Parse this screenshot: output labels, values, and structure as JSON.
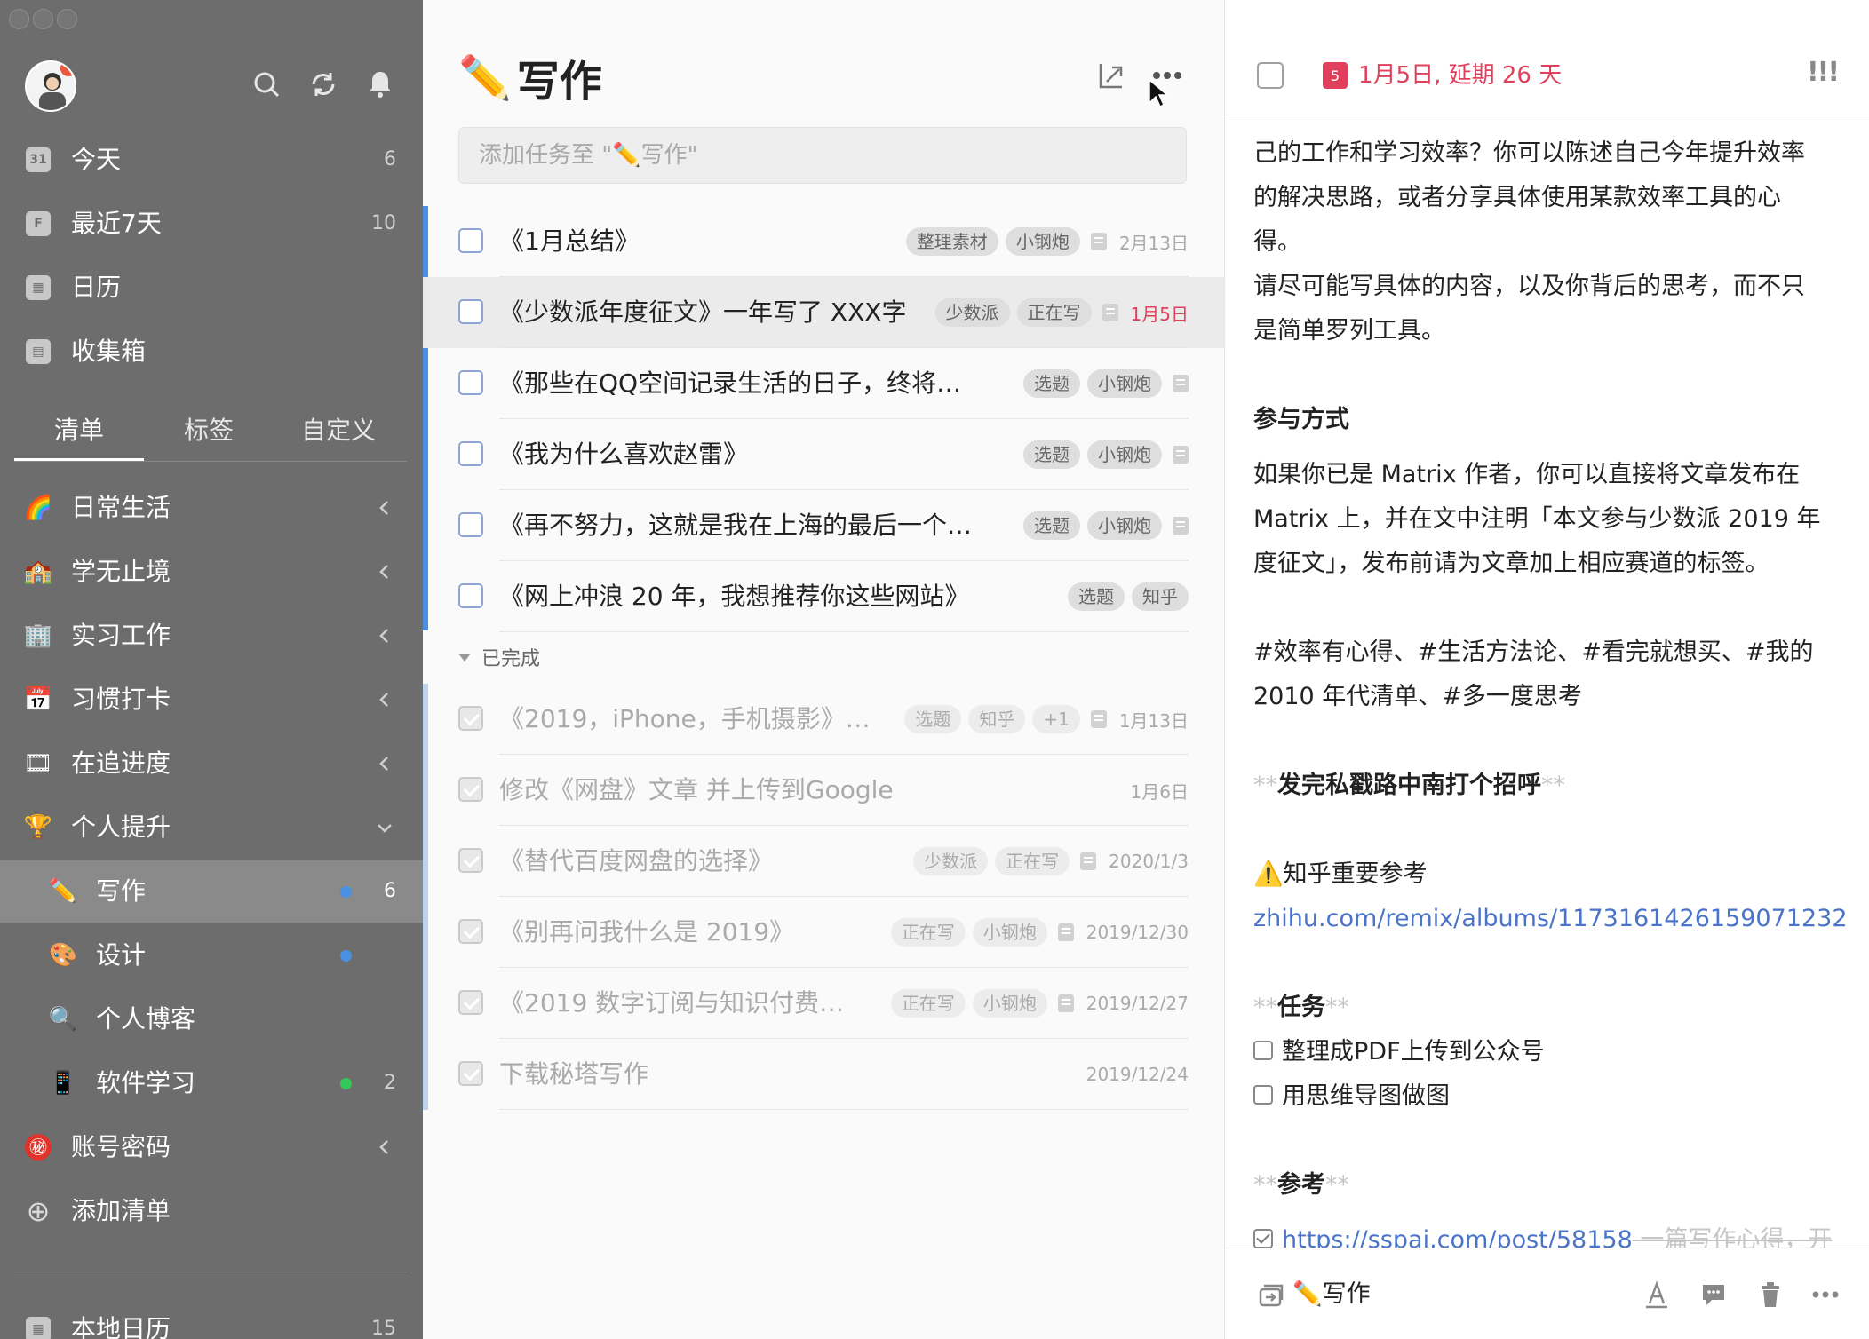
{
  "sidebar": {
    "smart_lists": [
      {
        "icon": "calendar-today-icon",
        "glyph": "31",
        "label": "今天",
        "count": "6"
      },
      {
        "icon": "calendar-week-icon",
        "glyph": "F",
        "label": "最近7天",
        "count": "10"
      },
      {
        "icon": "calendar-icon",
        "glyph": "▦",
        "label": "日历",
        "count": ""
      },
      {
        "icon": "inbox-icon",
        "glyph": "▤",
        "label": "收集箱",
        "count": ""
      }
    ],
    "tabs": [
      "清单",
      "标签",
      "自定义"
    ],
    "lists": [
      {
        "icon": "rainbow-icon",
        "glyph": "🌈",
        "label": "日常生活"
      },
      {
        "icon": "school-icon",
        "glyph": "🏫",
        "label": "学无止境"
      },
      {
        "icon": "office-icon",
        "glyph": "🏢",
        "label": "实习工作"
      },
      {
        "icon": "calendar-17-icon",
        "glyph": "📅",
        "label": "习惯打卡"
      },
      {
        "icon": "film-icon",
        "glyph": "🎞",
        "label": "在追进度"
      },
      {
        "icon": "trophy-icon",
        "glyph": "🏆",
        "label": "个人提升"
      }
    ],
    "sub_lists": [
      {
        "icon": "pencil-icon",
        "glyph": "✏️",
        "label": "写作",
        "count": "6",
        "dot": "#4a90e2"
      },
      {
        "icon": "palette-icon",
        "glyph": "🎨",
        "label": "设计",
        "count": "",
        "dot": "#4a90e2"
      },
      {
        "icon": "magnifier-icon",
        "glyph": "🔍",
        "label": "个人博客",
        "count": "",
        "dot": ""
      },
      {
        "icon": "app-icon",
        "glyph": "📱",
        "label": "软件学习",
        "count": "2",
        "dot": "#34c759"
      }
    ],
    "extra_lists": [
      {
        "icon": "secret-icon",
        "glyph": "㊙",
        "label": "账号密码"
      },
      {
        "icon": "add-circle-icon",
        "glyph": "⊕",
        "label": "添加清单"
      }
    ],
    "bottom": {
      "label": "本地日历",
      "count": "15"
    }
  },
  "list": {
    "title_emoji": "✏️",
    "title": "写作",
    "add_placeholder": "添加任务至 \"✏️写作\"",
    "tasks": [
      {
        "title": "《1月总结》",
        "tags": [
          "整理素材",
          "小钢炮"
        ],
        "note": true,
        "date": "2月13日",
        "date_red": false
      },
      {
        "title": "《少数派年度征文》一年写了 XXX字",
        "tags": [
          "少数派",
          "正在写"
        ],
        "note": true,
        "date": "1月5日",
        "date_red": true
      },
      {
        "title": "《那些在QQ空间记录生活的日子，终将…",
        "tags": [
          "选题",
          "小钢炮"
        ],
        "note": true,
        "date": "",
        "date_red": false
      },
      {
        "title": "《我为什么喜欢赵雷》",
        "tags": [
          "选题",
          "小钢炮"
        ],
        "note": true,
        "date": "",
        "date_red": false
      },
      {
        "title": "《再不努力，这就是我在上海的最后一个…",
        "tags": [
          "选题",
          "小钢炮"
        ],
        "note": true,
        "date": "",
        "date_red": false
      },
      {
        "title": "《网上冲浪 20 年，我想推荐你这些网站》",
        "tags": [
          "选题",
          "知乎"
        ],
        "note": false,
        "date": "",
        "date_red": false
      }
    ],
    "completed_label": "已完成",
    "completed": [
      {
        "title": "《2019，iPhone，手机摄影》…",
        "tags": [
          "选题",
          "知乎",
          "+1"
        ],
        "note": true,
        "date": "1月13日"
      },
      {
        "title": "修改《网盘》文章 并上传到Google",
        "tags": [],
        "note": false,
        "date": "1月6日"
      },
      {
        "title": "《替代百度网盘的选择》",
        "tags": [
          "少数派",
          "正在写"
        ],
        "note": true,
        "date": "2020/1/3"
      },
      {
        "title": "《别再问我什么是 2019》",
        "tags": [
          "正在写",
          "小钢炮"
        ],
        "note": true,
        "date": "2019/12/30"
      },
      {
        "title": "《2019 数字订阅与知识付费…",
        "tags": [
          "正在写",
          "小钢炮"
        ],
        "note": true,
        "date": "2019/12/27"
      },
      {
        "title": "下载秘塔写作",
        "tags": [],
        "note": false,
        "date": "2019/12/24"
      }
    ]
  },
  "detail": {
    "cal_day": "5",
    "date_text": "1月5日, 延期 26 天",
    "priority": "!!!",
    "body": {
      "l1": "己的工作和学习效率？你可以陈述自己今年提升效率",
      "l2": "的解决思路，或者分享具体使用某款效率工具的心",
      "l3": "得。",
      "l4": "请尽可能写具体的内容，以及你背后的思考，而不只",
      "l5": "是简单罗列工具。",
      "h_join": "参与方式",
      "l6": "如果你已是 Matrix 作者，你可以直接将文章发布在",
      "l7": "Matrix 上，并在文中注明「本文参与少数派 2019 年",
      "l8": "度征文」，发布前请为文章加上相应赛道的标签。",
      "l9": "#效率有心得、#生活方法论、#看完就想买、#我的",
      "l10": "2010 年代清单、#多一度思考",
      "md_marks": "**",
      "h_send": "发完私戳路中南打个招呼",
      "warn_emoji": "⚠️",
      "h_zhihu": "知乎重要参考",
      "zhihu_link": "zhihu.com/remix/albums/1173161426159071232",
      "h_task": "任务",
      "t1": "整理成PDF上传到公众号",
      "t2": "用思维导图做图",
      "h_ref": "参考",
      "ref_link": "https://sspai.com/post/58158",
      "ref_rest": " 一篇写作心得，开"
    },
    "footer_list_emoji": "✏️",
    "footer_list": "写作"
  }
}
